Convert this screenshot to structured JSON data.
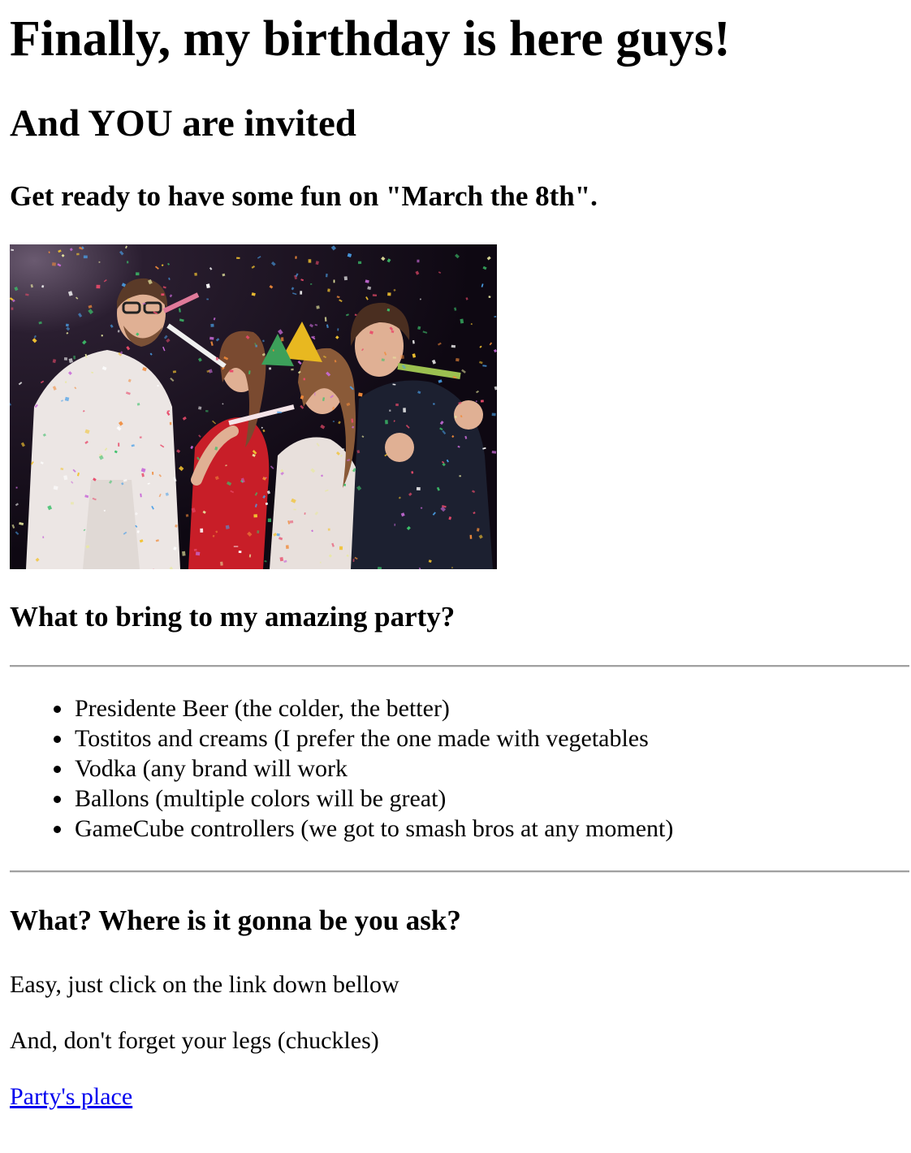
{
  "header": {
    "title": "Finally, my birthday is here guys!",
    "subtitle": "And YOU are invited",
    "date_line": "Get ready to have some fun on \"March the 8th\"."
  },
  "photo": {
    "icon": "party-photo-image",
    "colors": {
      "background": "#140c1a",
      "dress": "#c81e28",
      "shirt_light": "#ece6e4",
      "shirt_dark": "#1c2030",
      "skin": "#e0b094",
      "hair": "#5a3a28",
      "hat_yellow": "#e8b820",
      "hat_green": "#3ca05a"
    }
  },
  "bring": {
    "heading": "What to bring to my amazing party?",
    "items": [
      "Presidente Beer (the colder, the better)",
      "Tostitos and creams (I prefer the one made with vegetables",
      "Vodka (any brand will work",
      "Ballons (multiple colors will be great)",
      "GameCube controllers (we got to smash bros at any moment)"
    ]
  },
  "where": {
    "heading": "What? Where is it gonna be you ask?",
    "line1": "Easy, just click on the link down bellow",
    "line2": "And, don't forget your legs (chuckles)",
    "link_label": "Party's place",
    "link_color": "#0000ee"
  }
}
